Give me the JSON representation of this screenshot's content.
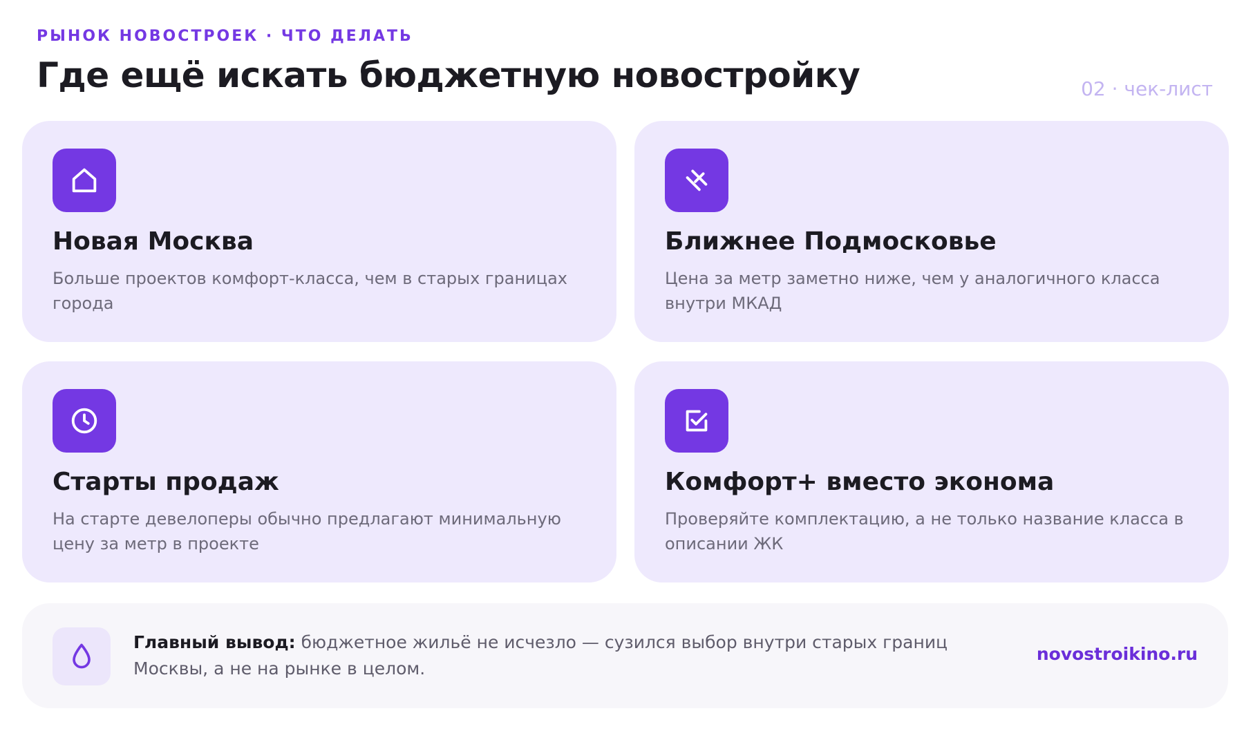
{
  "header": {
    "eyebrow": "РЫНОК НОВОСТРОЕК · ЧТО ДЕЛАТЬ",
    "title": "Где ещё искать бюджетную новостройку",
    "page_marker": "02 · чек-лист"
  },
  "cards": [
    {
      "icon": "house-icon",
      "title": "Новая Москва",
      "text": "Больше проектов комфорт-класса, чем в старых границах города"
    },
    {
      "icon": "route-icon",
      "title": "Ближнее Подмосковье",
      "text": "Цена за метр заметно ниже, чем у аналогичного класса внутри МКАД"
    },
    {
      "icon": "clock-icon",
      "title": "Старты продаж",
      "text": "На старте девелоперы обычно предлагают минимальную цену за метр в проекте"
    },
    {
      "icon": "checkbox-icon",
      "title": "Комфорт+ вместо эконома",
      "text": "Проверяйте комплектацию, а не только название класса в описании ЖК"
    }
  ],
  "footer": {
    "icon": "drop-icon",
    "conclusion_label": "Главный вывод:",
    "conclusion_text": " бюджетное жильё не исчезло — сузился выбор внутри старых границ Москвы, а не на рынке в целом.",
    "brand": "novostroikino.ru"
  },
  "colors": {
    "accent": "#7438e3",
    "card_background": "#eee9fd",
    "footer_background": "#f7f6fa",
    "muted_marker": "#c3b4f1"
  }
}
